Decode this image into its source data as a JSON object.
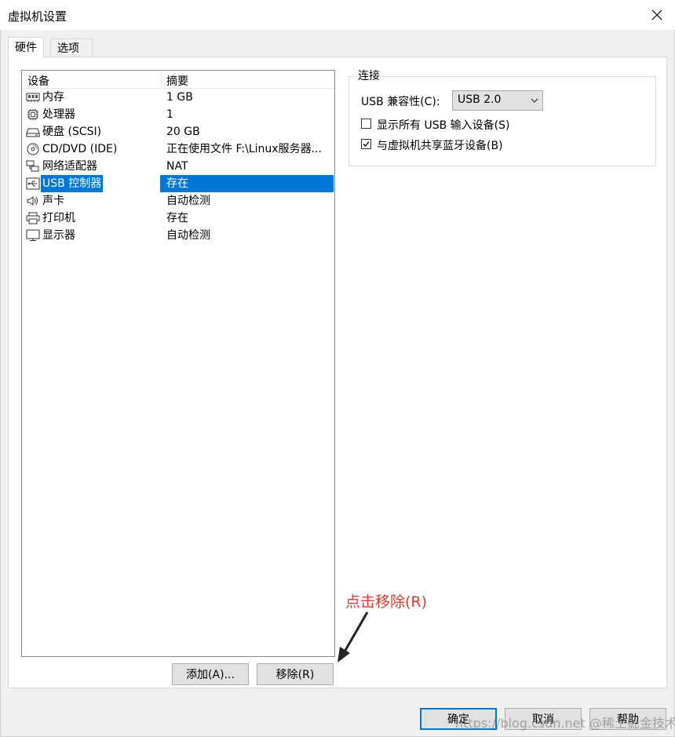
{
  "window": {
    "title": "虚拟机设置"
  },
  "tabs": [
    {
      "label": "硬件",
      "active": true
    },
    {
      "label": "选项",
      "active": false
    }
  ],
  "device_list": {
    "columns": [
      "设备",
      "摘要"
    ],
    "rows": [
      {
        "name": "内存",
        "summary": "1 GB",
        "icon": "memory-icon"
      },
      {
        "name": "处理器",
        "summary": "1",
        "icon": "processor-icon"
      },
      {
        "name": "硬盘 (SCSI)",
        "summary": "20 GB",
        "icon": "hard-disk-icon"
      },
      {
        "name": "CD/DVD (IDE)",
        "summary": "正在使用文件 F:\\Linux服务器...",
        "icon": "cd-dvd-icon"
      },
      {
        "name": "网络适配器",
        "summary": "NAT",
        "icon": "network-adapter-icon"
      },
      {
        "name": "USB 控制器",
        "summary": "存在",
        "icon": "usb-icon",
        "selected": true
      },
      {
        "name": "声卡",
        "summary": "自动检测",
        "icon": "speaker-icon"
      },
      {
        "name": "打印机",
        "summary": "存在",
        "icon": "printer-icon"
      },
      {
        "name": "显示器",
        "summary": "自动检测",
        "icon": "monitor-icon"
      }
    ]
  },
  "connection": {
    "legend": "连接",
    "compat_label": "USB 兼容性(C):",
    "compat_value": "USB 2.0",
    "show_all_label": "显示所有 USB 输入设备(S)",
    "show_all_checked": false,
    "share_bt_label": "与虚拟机共享蓝牙设备(B)",
    "share_bt_checked": true
  },
  "buttons": {
    "add": "添加(A)...",
    "remove": "移除(R)",
    "ok": "确定",
    "cancel": "取消",
    "help": "帮助"
  },
  "annotation": {
    "text": "点击移除(R)",
    "color": "#e8382f"
  },
  "watermark": "https://blog.csdn.net @稀土掘金技术社区",
  "colors": {
    "selection": "#0078d7",
    "button_bg": "#e1e1e1"
  }
}
